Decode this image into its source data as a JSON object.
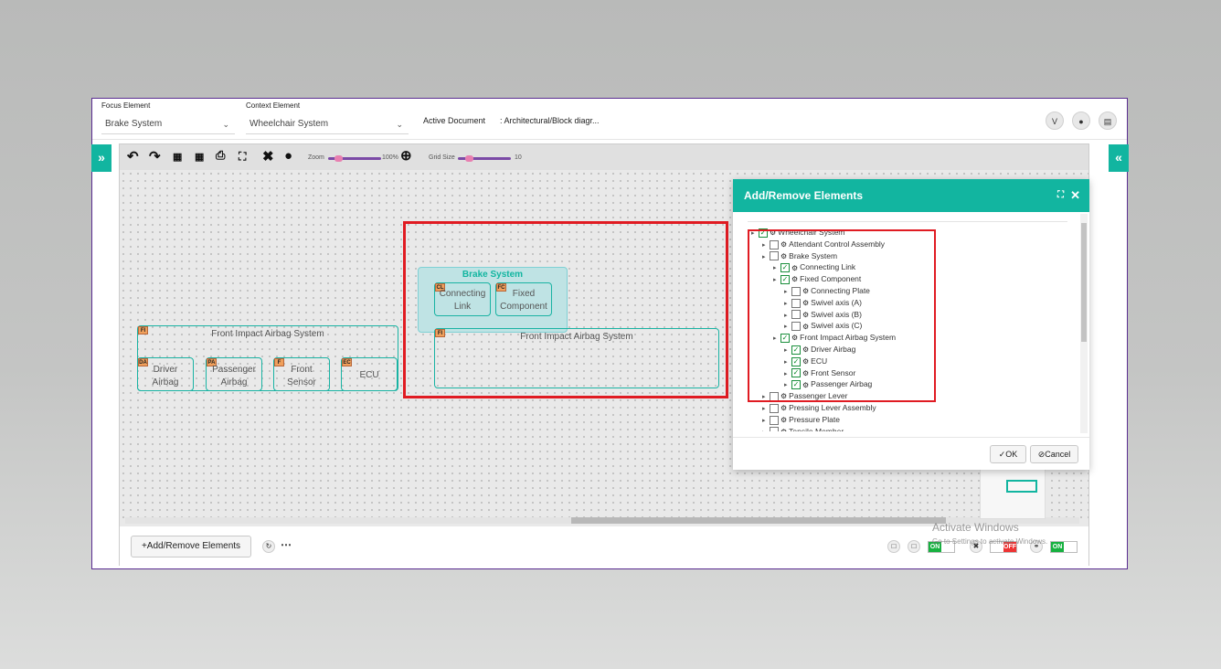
{
  "header": {
    "focus_label": "Focus Element",
    "focus_value": "Brake System",
    "context_label": "Context Element",
    "context_value": "Wheelchair System",
    "active_doc_label": "Active Document",
    "active_doc_value": ": Architectural/Block diagr..."
  },
  "side": {
    "left_expand": "»",
    "right_collapse": "«"
  },
  "toolbar": {
    "zoom_label": "Zoom",
    "zoom_value": "100%",
    "zoom_level": 1.0,
    "grid_label": "Grid Size",
    "grid_value": "10"
  },
  "diagram": {
    "group1": {
      "title": "Front Impact Airbag System",
      "tag": "FI"
    },
    "g1_children": [
      {
        "tag": "DA",
        "label": "Driver\nAirbag"
      },
      {
        "tag": "PA",
        "label": "Passenger\nAirbag"
      },
      {
        "tag": "F",
        "label": "Front\nSensor"
      },
      {
        "tag": "EC",
        "label": "ECU"
      }
    ],
    "brake": {
      "title": "Brake System"
    },
    "brake_children": [
      {
        "tag": "CL",
        "label": "Connecting\nLink"
      },
      {
        "tag": "FC",
        "label": "Fixed\nComponent"
      }
    ],
    "group2": {
      "title": "Front Impact Airbag System",
      "tag": "FI"
    }
  },
  "dialog": {
    "title": "Add/Remove Elements",
    "ok": "OK",
    "cancel": "Cancel",
    "tree": [
      {
        "label": "Wheelchair System",
        "checked": true
      },
      {
        "label": "Attendant Control Assembly",
        "checked": false
      },
      {
        "label": "Brake System",
        "checked": false
      },
      {
        "label": "Connecting Link",
        "checked": true
      },
      {
        "label": "Fixed Component",
        "checked": true
      },
      {
        "label": "Connecting Plate",
        "checked": false
      },
      {
        "label": "Swivel axis (A)",
        "checked": false
      },
      {
        "label": "Swivel axis (B)",
        "checked": false
      },
      {
        "label": "Swivel axis (C)",
        "checked": false
      },
      {
        "label": "Front Impact Airbag System",
        "checked": true
      },
      {
        "label": "Driver Airbag",
        "checked": true
      },
      {
        "label": "ECU",
        "checked": true
      },
      {
        "label": "Front Sensor",
        "checked": true
      },
      {
        "label": "Passenger Airbag",
        "checked": true
      },
      {
        "label": "Passenger Lever",
        "checked": false
      },
      {
        "label": "Pressing Lever Assembly",
        "checked": false
      },
      {
        "label": "Pressure Plate",
        "checked": false
      },
      {
        "label": "Tensile Member",
        "checked": false
      }
    ]
  },
  "footer": {
    "add_remove": "Add/Remove Elements",
    "toggle_on1": "ON",
    "toggle_off": "OFF",
    "toggle_on2": "ON"
  },
  "watermark": {
    "line1": "Activate Windows",
    "line2": "Go to Settings to activate Windows."
  },
  "colors": {
    "accent": "#12b5a0",
    "highlight": "#e01b22",
    "frame": "#5a2d91"
  }
}
